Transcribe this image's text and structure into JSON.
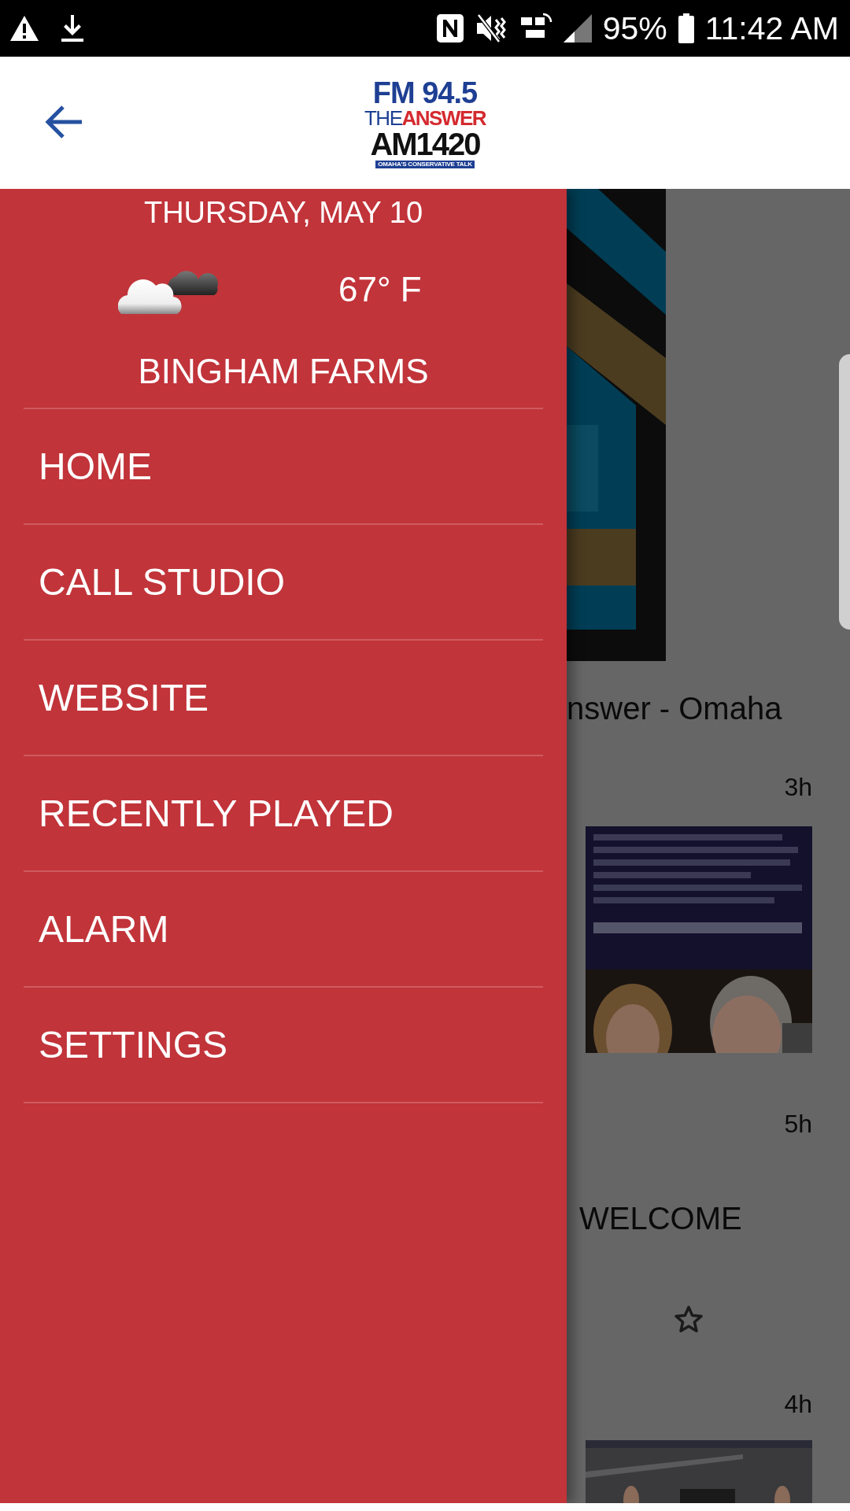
{
  "status_bar": {
    "battery": "95%",
    "time": "11:42 AM"
  },
  "header": {
    "logo": {
      "line_1": "FM 94.5",
      "line_2a": "THE",
      "line_2b": "ANSWER",
      "line_3": "AM1420",
      "tagline": "OMAHA'S CONSERVATIVE TALK"
    }
  },
  "drawer": {
    "date": "THURSDAY, MAY 10",
    "temperature": "67° F",
    "location": "BINGHAM FARMS",
    "items": [
      {
        "label": "HOME"
      },
      {
        "label": "CALL STUDIO"
      },
      {
        "label": "WEBSITE"
      },
      {
        "label": "RECENTLY PLAYED"
      },
      {
        "label": "ALARM"
      },
      {
        "label": "SETTINGS"
      }
    ]
  },
  "feed": [
    {
      "kind": "art"
    },
    {
      "kind": "title",
      "text": "nswer - Omaha"
    },
    {
      "kind": "time",
      "text": "3h"
    },
    {
      "kind": "picture"
    },
    {
      "kind": "time",
      "text": "5h"
    },
    {
      "kind": "headline",
      "text": "WELCOME"
    },
    {
      "kind": "star"
    },
    {
      "kind": "time",
      "text": "4h"
    },
    {
      "kind": "picture"
    }
  ]
}
